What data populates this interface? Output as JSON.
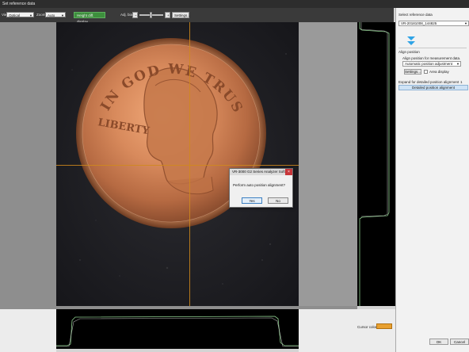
{
  "window": {
    "title": "Set reference data"
  },
  "toolbar": {
    "view_label": "View",
    "view_value": "Optical",
    "zoom_label": "Zoom",
    "zoom_value": "Auto",
    "height_diff_label": "Height diff. display",
    "height_diff_checked": true,
    "adj_label": "Adj. bias",
    "settings_label": "Settings..."
  },
  "coin": {
    "engraving_top": "IN GOD WE TRUST",
    "engraving_left": "LIBERTY"
  },
  "dialog": {
    "title": "VR-3000 G2 Series Analyzer Soft...",
    "message": "Perform auto position alignment?",
    "yes_label": "Yes",
    "no_label": "No"
  },
  "right_panel": {
    "select_reference_label": "Select reference data",
    "reference_value": "VR-20181008_144825",
    "align_position_label": "Align position",
    "align_desc": "Align position for measurement data.",
    "auto_position_value": "Automatic position adjustment",
    "settings_label": "Settings...",
    "area_display_label": "Area display",
    "area_display_checked": false,
    "expand_label": "Expand for detailed position alignment",
    "expand_count": "1",
    "detailed_button_label": "Detailed position alignment"
  },
  "status": {
    "cursor_color_label": "Cursor color",
    "cursor_color": "#e8a030"
  },
  "buttons": {
    "ok_label": "OK",
    "cancel_label": "Cancel"
  },
  "colors": {
    "profile_line": "#8fd08f",
    "crosshair": "#d08a1c",
    "accent_chevron": "#2fa3e6"
  }
}
